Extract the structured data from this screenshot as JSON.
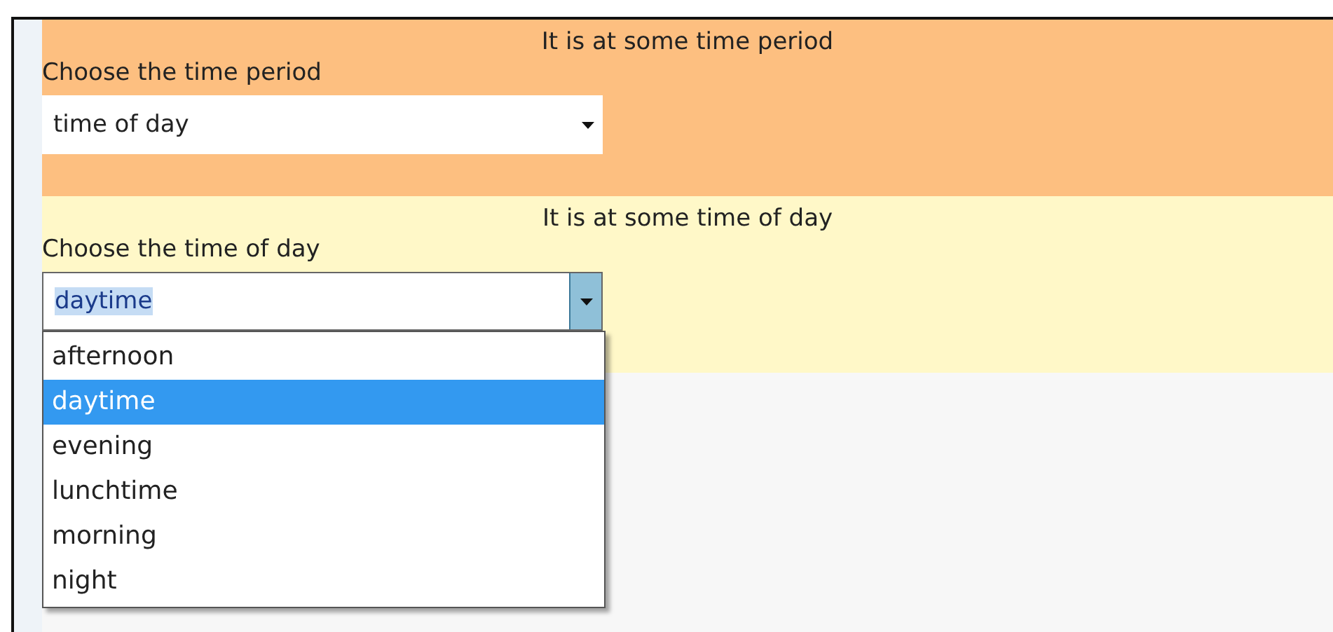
{
  "panels": [
    {
      "color": "#fdbf80",
      "heading": "It is at some time period",
      "label": "Choose the time period",
      "combo": {
        "value": "time of day",
        "open": false
      }
    },
    {
      "color": "#fff8c8",
      "heading": "It is at some time of day",
      "label": "Choose the time of day",
      "combo": {
        "value": "daytime",
        "open": true,
        "options": [
          {
            "label": "afternoon",
            "selected": false
          },
          {
            "label": "daytime",
            "selected": true
          },
          {
            "label": "evening",
            "selected": false
          },
          {
            "label": "lunchtime",
            "selected": false
          },
          {
            "label": "morning",
            "selected": false
          },
          {
            "label": "night",
            "selected": false
          }
        ]
      }
    }
  ]
}
